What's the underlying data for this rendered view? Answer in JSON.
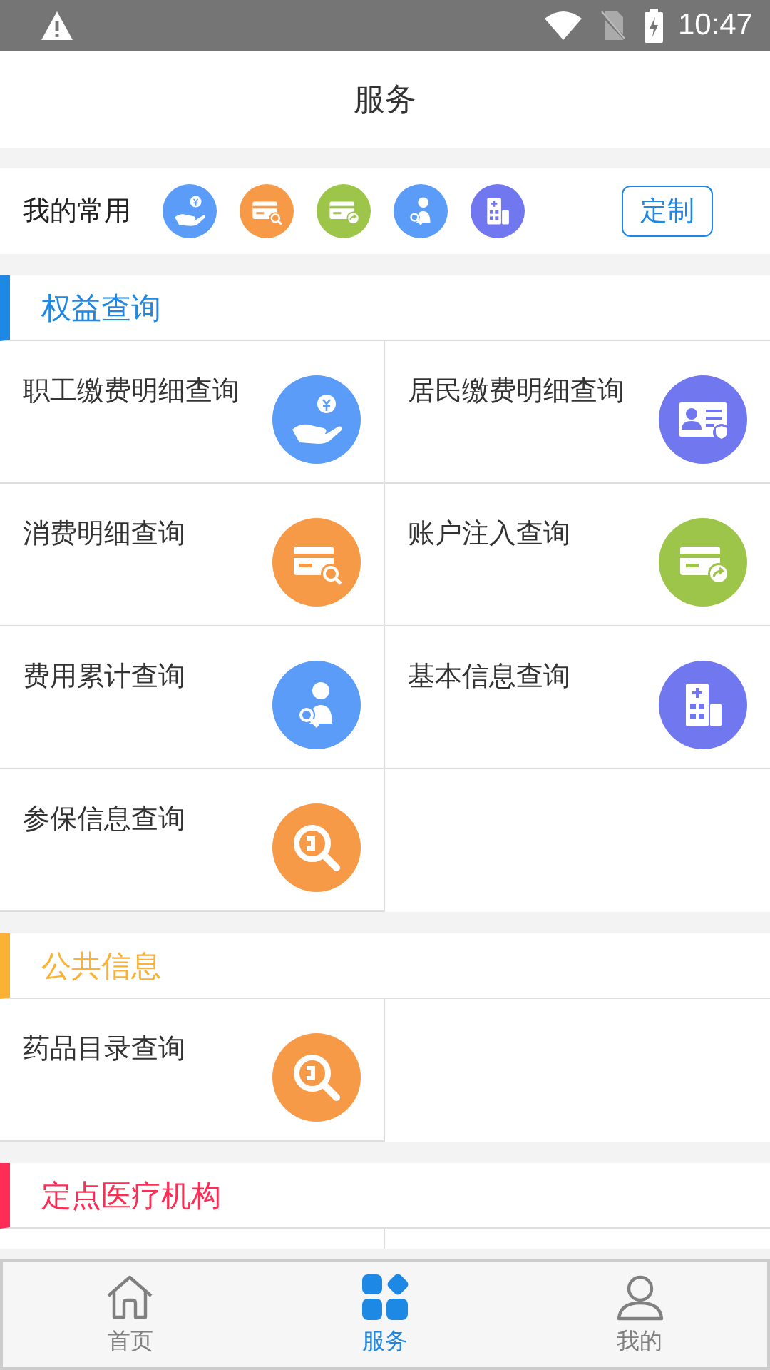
{
  "status_bar": {
    "time": "10:47"
  },
  "header": {
    "title": "服务"
  },
  "favorites": {
    "label": "我的常用",
    "icons": [
      {
        "kind": "hand-coin",
        "color": "#5b9cf8"
      },
      {
        "kind": "card-search",
        "color": "#f79a47"
      },
      {
        "kind": "card-arrow",
        "color": "#9dc54a"
      },
      {
        "kind": "person-search",
        "color": "#5b9cf8"
      },
      {
        "kind": "hospital",
        "color": "#7177ee"
      }
    ],
    "button": "定制"
  },
  "sections": [
    {
      "title": "权益查询",
      "color": "#1e88e5",
      "items": [
        {
          "label": "职工缴费明细查询",
          "kind": "hand-coin",
          "color": "#5b9cf8"
        },
        {
          "label": "居民缴费明细查询",
          "kind": "id-card",
          "color": "#7177ee"
        },
        {
          "label": "消费明细查询",
          "kind": "card-search",
          "color": "#f79a47"
        },
        {
          "label": "账户注入查询",
          "kind": "card-arrow",
          "color": "#9dc54a"
        },
        {
          "label": "费用累计查询",
          "kind": "person-search",
          "color": "#5b9cf8"
        },
        {
          "label": "基本信息查询",
          "kind": "hospital",
          "color": "#7177ee"
        },
        {
          "label": "参保信息查询",
          "kind": "doc-search",
          "color": "#f79a47"
        }
      ]
    },
    {
      "title": "公共信息",
      "color": "#f9b233",
      "items": [
        {
          "label": "药品目录查询",
          "kind": "doc-search",
          "color": "#f79a47"
        }
      ]
    },
    {
      "title": "定点医疗机构",
      "color": "#ff2d55"
    }
  ],
  "tab_bar": [
    {
      "label": "首页",
      "kind": "home",
      "selected": false
    },
    {
      "label": "服务",
      "kind": "grid",
      "selected": true
    },
    {
      "label": "我的",
      "kind": "person",
      "selected": false
    }
  ]
}
